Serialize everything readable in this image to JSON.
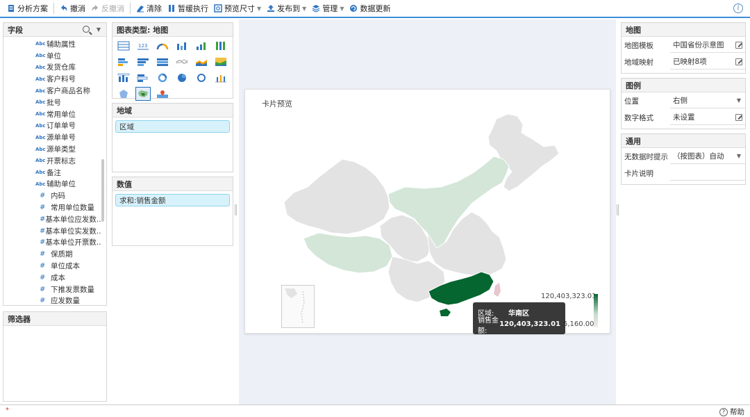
{
  "toolbar": {
    "items": [
      {
        "label": "分析方案"
      },
      {
        "label": "撤消"
      },
      {
        "label": "反撤消"
      },
      {
        "label": "清除"
      },
      {
        "label": "暂缓执行"
      },
      {
        "label": "预览尺寸"
      },
      {
        "label": "发布到"
      },
      {
        "label": "管理"
      },
      {
        "label": "数据更新"
      }
    ]
  },
  "fields": {
    "title": "字段",
    "items": [
      {
        "type": "Abc",
        "label": "辅助属性"
      },
      {
        "type": "Abc",
        "label": "单位"
      },
      {
        "type": "Abc",
        "label": "发货仓库"
      },
      {
        "type": "Abc",
        "label": "客户料号"
      },
      {
        "type": "Abc",
        "label": "客户商品名称"
      },
      {
        "type": "Abc",
        "label": "批号"
      },
      {
        "type": "Abc",
        "label": "常用单位"
      },
      {
        "type": "Abc",
        "label": "订单单号"
      },
      {
        "type": "Abc",
        "label": "源单单号"
      },
      {
        "type": "Abc",
        "label": "源单类型"
      },
      {
        "type": "Abc",
        "label": "开票标志"
      },
      {
        "type": "Abc",
        "label": "备注"
      },
      {
        "type": "Abc",
        "label": "辅助单位"
      },
      {
        "type": "#",
        "label": "内码"
      },
      {
        "type": "#",
        "label": "常用单位数量"
      },
      {
        "type": "#",
        "label": "基本单位应发数..."
      },
      {
        "type": "#",
        "label": "基本单位实发数..."
      },
      {
        "type": "#",
        "label": "基本单位开票数..."
      },
      {
        "type": "#",
        "label": "保质期"
      },
      {
        "type": "#",
        "label": "单位成本"
      },
      {
        "type": "#",
        "label": "成本"
      },
      {
        "type": "#",
        "label": "下推发票数量"
      },
      {
        "type": "#",
        "label": "应发数量"
      }
    ]
  },
  "filter": {
    "title": "筛选器"
  },
  "chart_type": {
    "title": "图表类型: 地图"
  },
  "dimension": {
    "title": "地域",
    "field": "区域"
  },
  "value": {
    "title": "数值",
    "field": "求和:销售金额"
  },
  "card": {
    "title": "卡片预览",
    "legend_max": "120,403,323.01",
    "legend_min": "5,160.00",
    "tooltip": {
      "region_label": "区域:",
      "region_value": "华南区",
      "amount_label": "销售金额:",
      "amount_value": "120,403,323.01"
    }
  },
  "props": {
    "map": {
      "title": "地图",
      "template_label": "地图模板",
      "template_value": "中国省份示意图",
      "mapping_label": "地域映射",
      "mapping_value": "已映射8项"
    },
    "legend": {
      "title": "图例",
      "position_label": "位置",
      "position_value": "右侧",
      "format_label": "数字格式",
      "format_value": "未设置"
    },
    "general": {
      "title": "通用",
      "nodata_label": "无数据时提示",
      "nodata_value": "（按图表）自动",
      "desc_label": "卡片说明",
      "desc_value": ""
    }
  },
  "status": {
    "help": "帮助",
    "mark": "*"
  },
  "colors": {
    "accent": "#3a8fd8",
    "region_dark": "#056630",
    "region_mid": "#d3e6d8",
    "region_none": "#e3e3e3",
    "taiwan": "#e7c6cd"
  }
}
